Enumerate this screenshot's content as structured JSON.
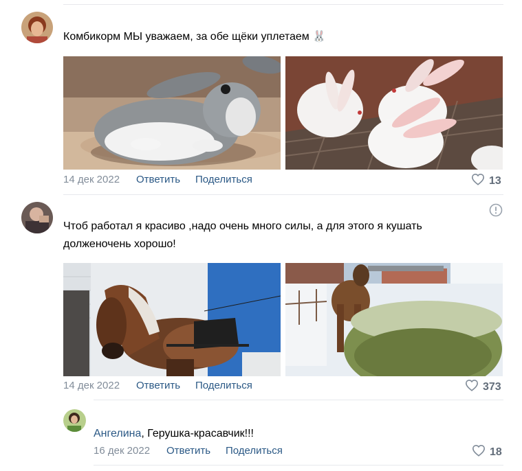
{
  "comments": [
    {
      "text": "Комбикорм МЫ уважаем, за обе щёки уплетаем 🐰",
      "date": "14 дек 2022",
      "reply_label": "Ответить",
      "share_label": "Поделиться",
      "likes": "13"
    },
    {
      "text": "Чтоб работал я красиво ,надо очень много силы, а для этого я кушать долженочень хорошо!",
      "date": "14 дек 2022",
      "reply_label": "Ответить",
      "share_label": "Поделиться",
      "likes": "373"
    }
  ],
  "reply": {
    "author": "Ангелина",
    "text": ", Герушка-красавчик!!!",
    "date": "16 дек 2022",
    "reply_label": "Ответить",
    "share_label": "Поделиться",
    "likes": "18"
  },
  "icons": {
    "like": "heart-icon",
    "report": "exclamation-circle-icon"
  },
  "colors": {
    "link": "#2a5885",
    "meta": "#818c99",
    "divider": "#e7e8ec"
  }
}
